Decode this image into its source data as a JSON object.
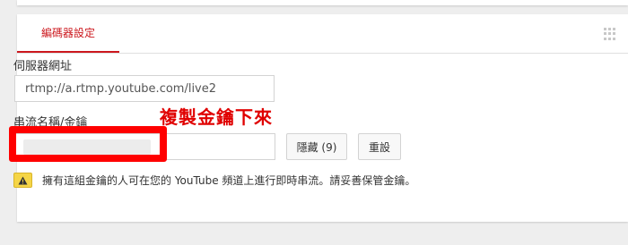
{
  "tab": {
    "label": "編碼器設定"
  },
  "server": {
    "label": "伺服器網址",
    "value": "rtmp://a.rtmp.youtube.com/live2"
  },
  "stream_key": {
    "label": "串流名稱/金鑰"
  },
  "buttons": {
    "hide_label": "隱藏 (9)",
    "reset_label": "重設"
  },
  "annotation": {
    "text": "複製金鑰下來",
    "color": "#ff0000"
  },
  "warning": {
    "text": "擁有這組金鑰的人可在您的 YouTube 頻道上進行即時串流。請妥善保管金鑰。",
    "icon": "warning-icon"
  },
  "colors": {
    "accent": "#cc181e",
    "warning": "#f5d547"
  }
}
